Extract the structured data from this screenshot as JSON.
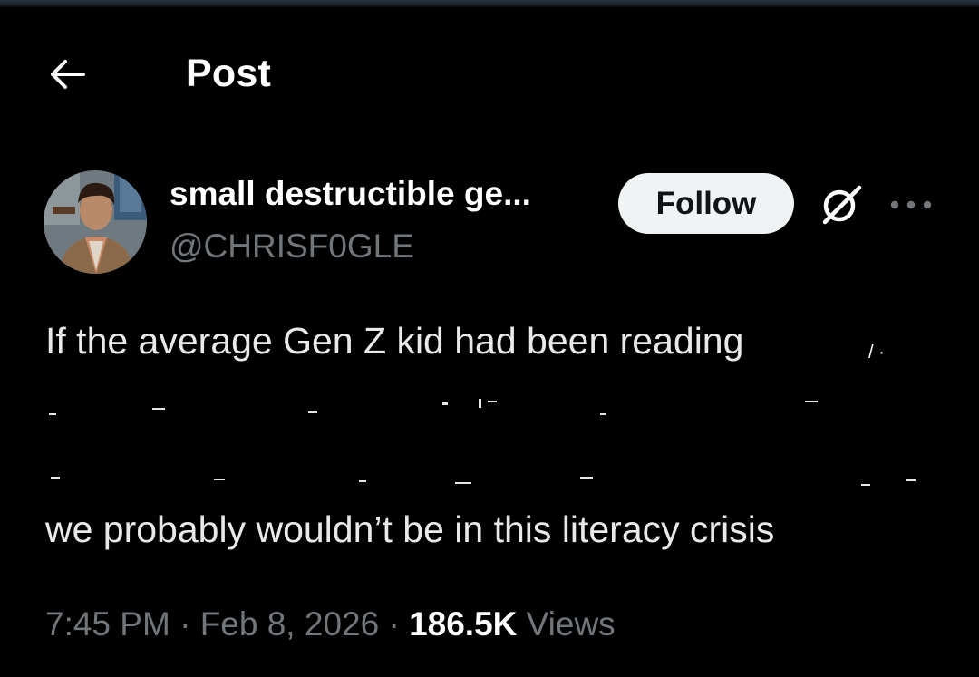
{
  "header": {
    "title": "Post",
    "back_icon": "arrow-left-icon"
  },
  "author": {
    "display_name": "small destructible ge...",
    "handle": "@CHRISF0GLE",
    "follow_label": "Follow",
    "grok_icon": "grok-icon",
    "more_icon": "more-horizontal-icon"
  },
  "post": {
    "line_first": "If the average Gen Z kid had been reading",
    "line_last": "we probably wouldn’t be in this literacy crisis"
  },
  "meta": {
    "time": "7:45 PM",
    "separator": " · ",
    "date": "Feb 8, 2026",
    "views_count": "186.5K",
    "views_label": "Views"
  },
  "colors": {
    "background": "#000000",
    "text_primary": "#e7e9ea",
    "text_secondary": "#71767b",
    "follow_bg": "#eff3f4",
    "follow_text": "#0f1419"
  }
}
